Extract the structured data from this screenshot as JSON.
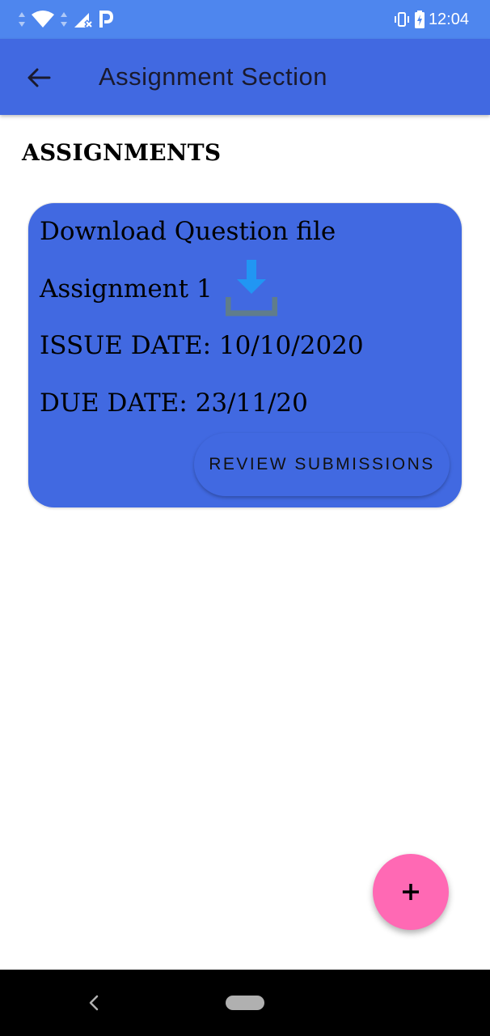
{
  "status_bar": {
    "time": "12:04",
    "icons": [
      "data-arrows-icon",
      "wifi-icon",
      "signal-off-icon",
      "parking-p-icon",
      "vibrate-icon",
      "battery-charging-icon"
    ]
  },
  "app_bar": {
    "title": "Assignment Section",
    "back_icon": "arrow-left-icon"
  },
  "section": {
    "heading": "ASSIGNMENTS"
  },
  "assignment_card": {
    "download_label": "Download Question file",
    "assignment_name": "Assignment 1",
    "download_icon": "download-icon",
    "issue_date": "ISSUE DATE: 10/10/2020",
    "due_date": "DUE DATE: 23/11/20",
    "review_button_label": "REVIEW SUBMISSIONS"
  },
  "fab": {
    "icon": "plus-icon"
  },
  "nav_bar": {
    "icons": [
      "chevron-left-icon",
      "home-pill-icon"
    ]
  },
  "colors": {
    "status_bar": "#4e86ee",
    "app_bar": "#4169e1",
    "card": "#4169e1",
    "fab": "#ff69b4",
    "download_arrow": "#2196f3",
    "download_tray": "#607d8b"
  }
}
